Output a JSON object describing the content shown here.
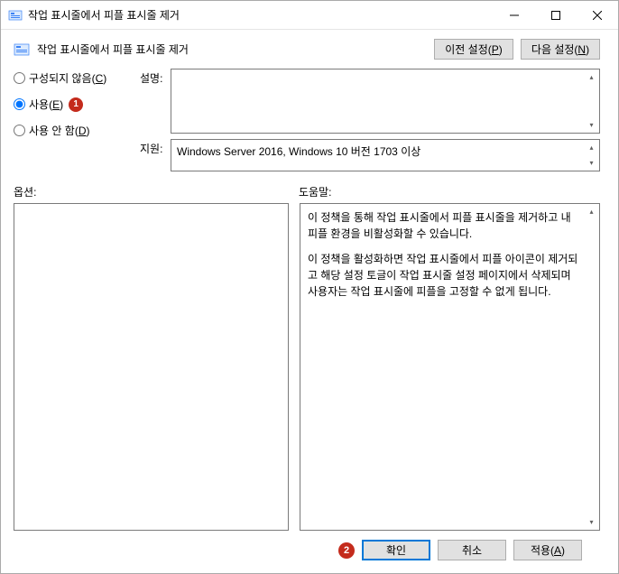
{
  "window": {
    "title": "작업 표시줄에서 피플 표시줄 제거"
  },
  "header": {
    "title": "작업 표시줄에서 피플 표시줄 제거",
    "prev_button": "이전 설정",
    "prev_key": "P",
    "next_button": "다음 설정",
    "next_key": "N"
  },
  "radios": {
    "not_configured": "구성되지 않음",
    "not_configured_key": "C",
    "enabled": "사용",
    "enabled_key": "E",
    "disabled": "사용 안 함",
    "disabled_key": "D",
    "selected": "enabled"
  },
  "callouts": {
    "one": "1",
    "two": "2"
  },
  "fields": {
    "desc_label": "설명:",
    "desc_value": "",
    "support_label": "지원:",
    "support_value": "Windows Server 2016, Windows 10 버전 1703 이상"
  },
  "labels": {
    "options": "옵션:",
    "help": "도움말:"
  },
  "help": {
    "p1": "이 정책을 통해 작업 표시줄에서 피플 표시줄을 제거하고 내 피플 환경을 비활성화할 수 있습니다.",
    "p2": "이 정책을 활성화하면 작업 표시줄에서 피플 아이콘이 제거되고 해당 설정 토글이 작업 표시줄 설정 페이지에서 삭제되며 사용자는 작업 표시줄에 피플을 고정할 수 없게 됩니다."
  },
  "footer": {
    "ok": "확인",
    "cancel": "취소",
    "apply": "적용",
    "apply_key": "A"
  }
}
